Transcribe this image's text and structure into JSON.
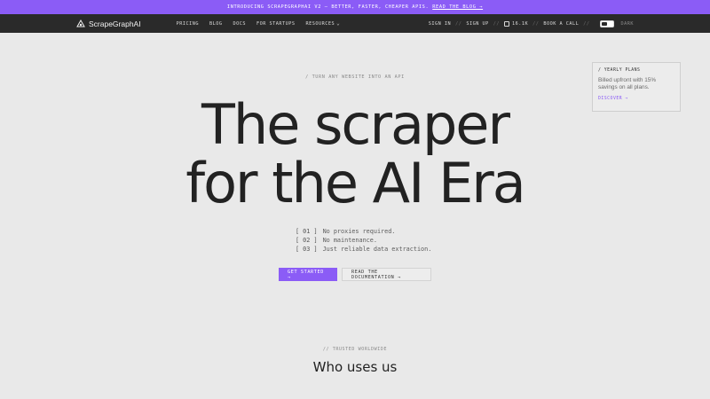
{
  "announcement": {
    "text": "INTRODUCING SCRAPEGRAPHAI V2 – BETTER, FASTER, CHEAPER APIS.",
    "link": "READ THE BLOG →"
  },
  "nav": {
    "logo_text": "ScrapeGraphAI",
    "menu": [
      "PRICING",
      "BLOG",
      "DOCS",
      "FOR STARTUPS",
      "RESOURCES"
    ],
    "sign_in": "SIGN IN",
    "sign_up": "SIGN UP",
    "github_stars": "16.1K",
    "book_call": "BOOK A CALL",
    "theme_label": "DARK",
    "separator": "//"
  },
  "hero": {
    "eyebrow": "/ TURN ANY WEBSITE INTO AN API",
    "headline_line1": "The scraper",
    "headline_line2": "for the AI Era",
    "points": [
      {
        "num": "[ 01 ]",
        "text": "No proxies required."
      },
      {
        "num": "[ 02 ]",
        "text": "No maintenance."
      },
      {
        "num": "[ 03 ]",
        "text": "Just reliable data extraction."
      }
    ],
    "cta_primary": "GET STARTED →",
    "cta_secondary": "READ THE DOCUMENTATION →"
  },
  "promo": {
    "title": "/ YEARLY PLANS",
    "body": "Billed upfront with 15% savings on all plans.",
    "link": "DISCOVER →"
  },
  "trusted": {
    "eyebrow": "// TRUSTED WORLDWIDE",
    "title": "Who uses us"
  },
  "colors": {
    "accent": "#8b5cf6",
    "nav_bg": "#2a2a2a",
    "page_bg": "#e9e9e9"
  }
}
